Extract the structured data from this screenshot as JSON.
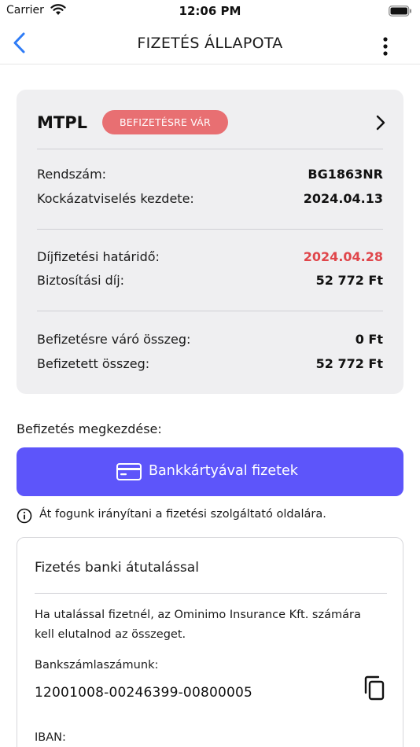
{
  "status_bar": {
    "carrier": "Carrier",
    "time": "12:06 PM"
  },
  "nav": {
    "title": "FIZETÉS ÁLLAPOTA",
    "back_icon": "chevron-left-icon",
    "more_icon": "more-vertical-icon"
  },
  "summary": {
    "product": "MTPL",
    "status": "BEFIZETÉSRE VÁR",
    "rows": [
      {
        "label": "Rendszám:",
        "value": "BG1863NR"
      },
      {
        "label": "Kockázatviselés kezdete:",
        "value": "2024.04.13"
      },
      {
        "label": "Díjfizetési határidő:",
        "value": "2024.04.28"
      },
      {
        "label": "Biztosítási díj:",
        "value": "52 772 Ft"
      },
      {
        "label": "Befizetésre váró összeg:",
        "value": "0 Ft"
      },
      {
        "label": "Befizetett összeg:",
        "value": "52 772 Ft"
      }
    ]
  },
  "payment": {
    "section_label": "Befizetés megkezdése:",
    "card_button_label": "Bankkártyával fizetek",
    "info_text": "Át fogunk irányítani a fizetési szolgáltató oldalára."
  },
  "transfer": {
    "title": "Fizetés banki átutalással",
    "description": "Ha utalással fizetnél, az Ominimo Insurance Kft. számára kell elutalnod az összeget.",
    "bank_account_label": "Bankszámlaszámunk:",
    "bank_account_number": "12001008-00246399-00800005",
    "iban_label": "IBAN:"
  },
  "colors": {
    "accent": "#5d55fa",
    "badge": "#e86f72",
    "danger_text": "#e0464b",
    "back_arrow": "#2f7cf6",
    "card_bg": "#efeff1"
  }
}
